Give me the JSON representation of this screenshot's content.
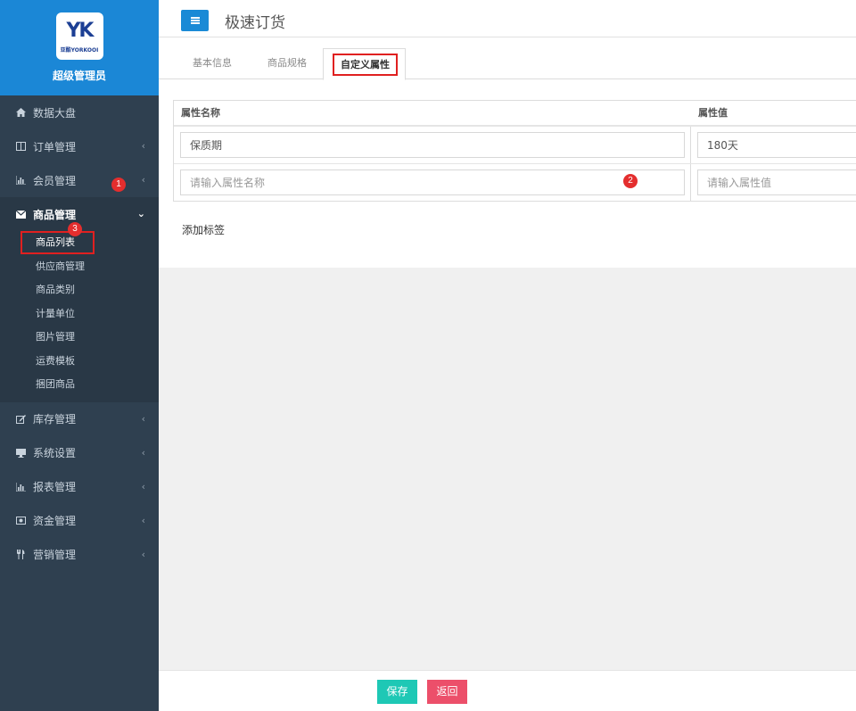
{
  "brand": {
    "logo_mark": "YK",
    "logo_sub": "亚酷YORKOOI",
    "admin_name": "超级管理员"
  },
  "menu": {
    "items": [
      {
        "label": "数据大盘",
        "icon": "home-icon"
      },
      {
        "label": "订单管理",
        "icon": "columns-icon"
      },
      {
        "label": "会员管理",
        "icon": "bar-chart-icon"
      },
      {
        "label": "商品管理",
        "icon": "envelope-icon",
        "expanded": true
      },
      {
        "label": "库存管理",
        "icon": "edit-icon"
      },
      {
        "label": "系统设置",
        "icon": "monitor-icon"
      },
      {
        "label": "报表管理",
        "icon": "bar-chart-icon"
      },
      {
        "label": "资金管理",
        "icon": "money-icon"
      },
      {
        "label": "营销管理",
        "icon": "cutlery-icon"
      }
    ],
    "submenu": [
      "商品列表",
      "供应商管理",
      "商品类别",
      "计量单位",
      "图片管理",
      "运费模板",
      "捆团商品"
    ]
  },
  "header": {
    "title": "极速订货"
  },
  "tabs": {
    "basic": "基本信息",
    "spec": "商品规格",
    "custom": "自定义属性"
  },
  "table": {
    "col_name": "属性名称",
    "col_value": "属性值",
    "rows": [
      {
        "name": "保质期",
        "value": "180天"
      }
    ],
    "new_row": {
      "name_placeholder": "请输入属性名称",
      "value_placeholder": "请输入属性值"
    }
  },
  "add_tag_label": "添加标签",
  "badges": [
    "1",
    "2",
    "3"
  ],
  "footer": {
    "save": "保存",
    "back": "返回"
  },
  "colors": {
    "sidebar": "#2f4050",
    "brand": "#1b87d6",
    "save": "#1ec8b5",
    "back": "#ec4f6a",
    "highlight": "#e02020"
  }
}
